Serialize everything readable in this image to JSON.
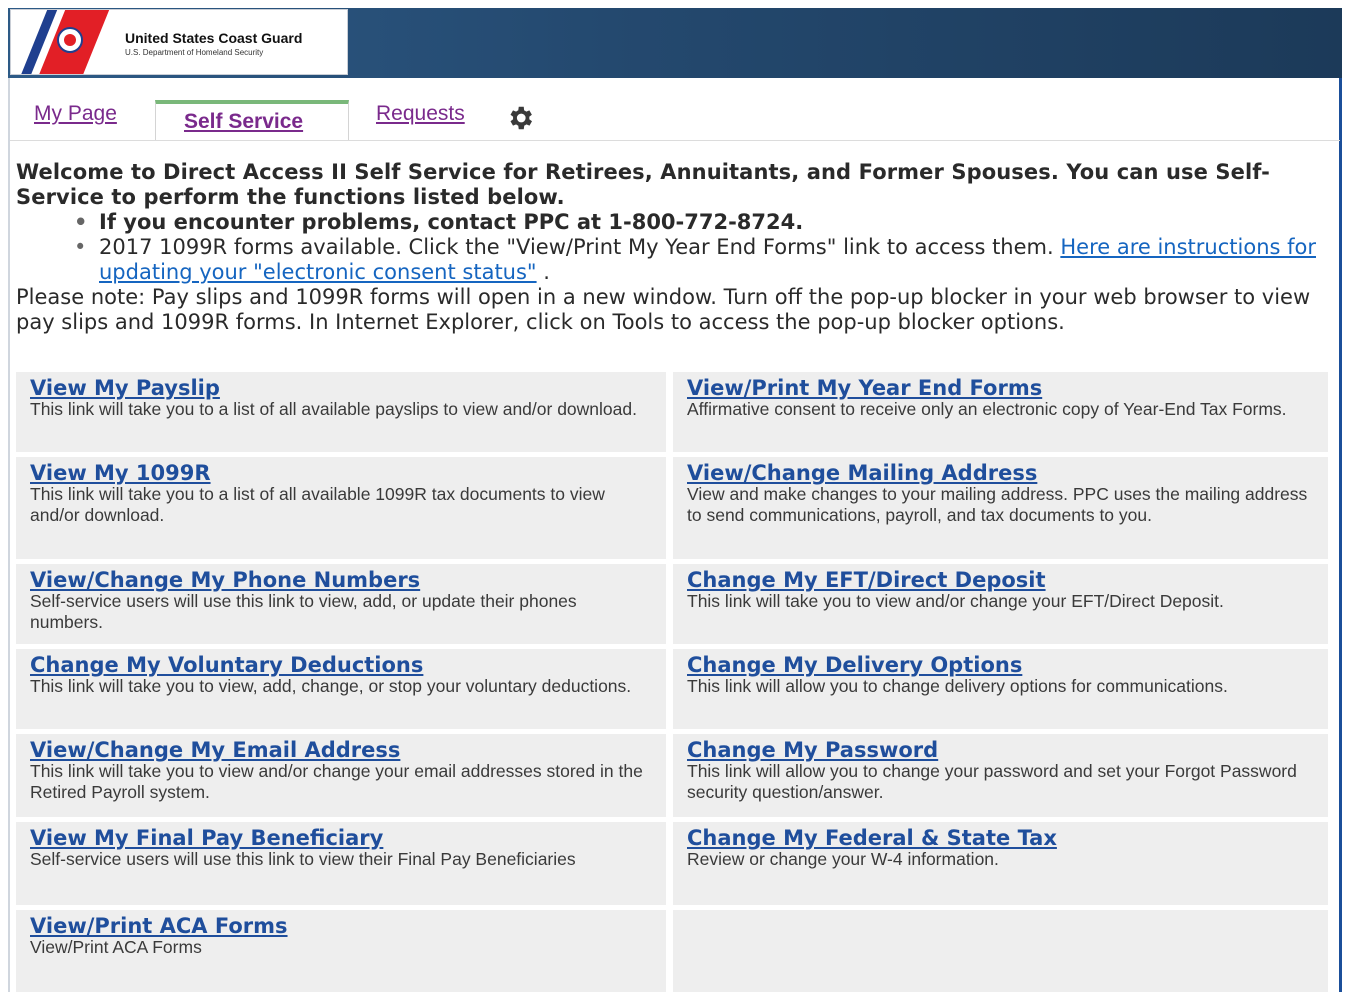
{
  "header": {
    "org_name": "United States Coast Guard",
    "org_sub": "U.S. Department of Homeland Security"
  },
  "tabs": [
    {
      "label": "My Page"
    },
    {
      "label": "Self Service",
      "selected": true
    },
    {
      "label": "Requests"
    }
  ],
  "icons": {
    "settings": "gear-icon"
  },
  "intro": {
    "welcome": "Welcome to Direct Access II Self Service for Retirees, Annuitants, and Former Spouses. You can use Self-Service to perform the functions listed below.",
    "bullet1": "If you encounter problems, contact PPC at 1-800-772-8724.",
    "bullet2_text": "2017 1099R forms available. Click the \"View/Print My Year End Forms\" link to access them.",
    "bullet2_link": "Here are instructions for updating your \"electronic consent status\"",
    "bullet2_end": ".",
    "note": "Please note: Pay slips and 1099R forms will open in a new window. Turn off the pop-up blocker in your web browser to view pay slips and 1099R forms. In Internet Explorer, click on Tools to access the pop-up blocker options."
  },
  "links": [
    {
      "title": "View My Payslip",
      "desc": "This link will take you to a list of all available payslips to view and/or download."
    },
    {
      "title": "View/Print My Year End Forms",
      "desc": "Affirmative consent to receive only an electronic copy of Year-End Tax Forms."
    },
    {
      "title": "View My 1099R",
      "desc": "This link will take you to a list of all available 1099R tax documents to view and/or download."
    },
    {
      "title": "View/Change Mailing Address",
      "desc": "View and make changes to your mailing address. PPC uses the mailing address to send communications, payroll, and tax documents to you."
    },
    {
      "title": "View/Change My Phone Numbers",
      "desc": "Self-service users will use this link to view, add, or update their phones numbers."
    },
    {
      "title": "Change My EFT/Direct Deposit",
      "desc": "This link will take you to view and/or change your EFT/Direct Deposit."
    },
    {
      "title": "Change My Voluntary Deductions",
      "desc": "This link will take you to view, add, change, or stop your voluntary deductions."
    },
    {
      "title": "Change My Delivery Options",
      "desc": "This link will allow you to change delivery options for communications."
    },
    {
      "title": "View/Change My Email Address",
      "desc": "This link will take you to view and/or change your email addresses stored in the Retired Payroll system."
    },
    {
      "title": "Change My Password",
      "desc": "This link will allow you to change your password and set your Forgot Password security question/answer."
    },
    {
      "title": "View My Final Pay Beneficiary",
      "desc": "Self-service users will use this link to view their Final Pay Beneficiaries"
    },
    {
      "title": "Change My Federal & State Tax",
      "desc": "Review or change your W-4 information."
    },
    {
      "title": "View/Print ACA Forms",
      "desc": "View/Print ACA Forms"
    }
  ]
}
